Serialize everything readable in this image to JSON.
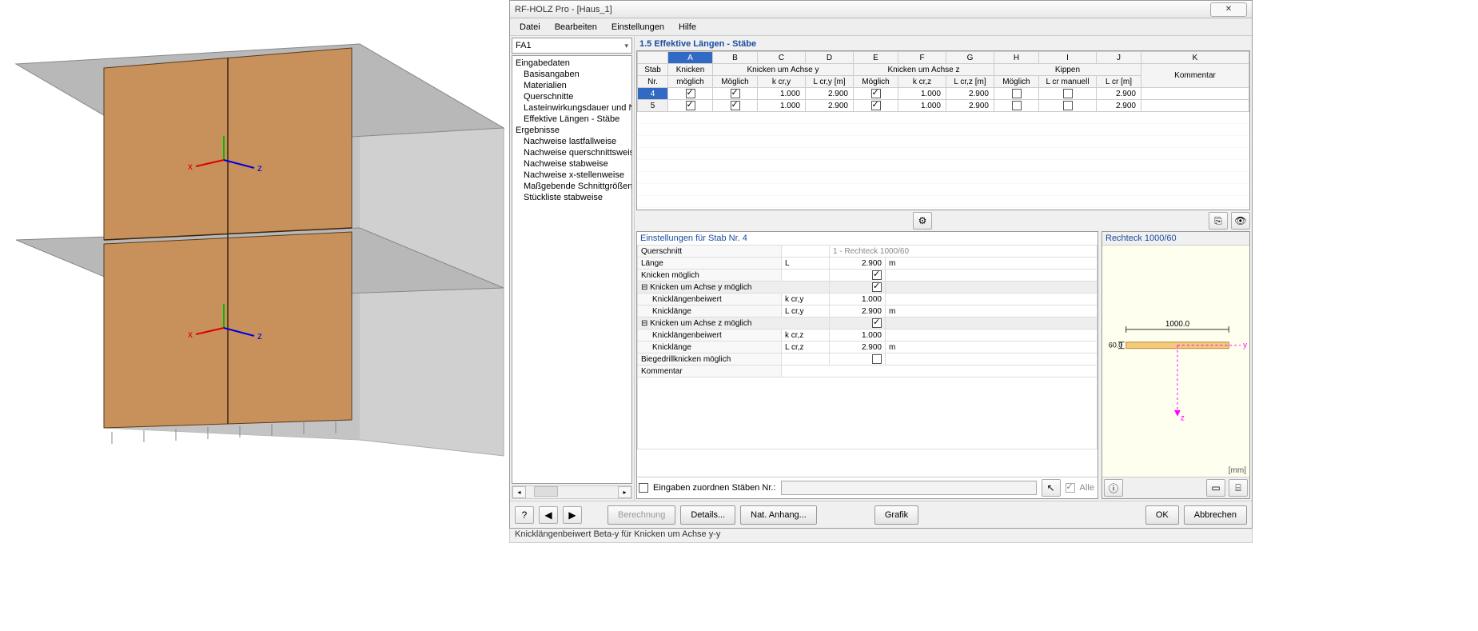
{
  "dialog": {
    "title": "RF-HOLZ Pro - [Haus_1]",
    "close_glyph": "✕"
  },
  "menu": {
    "items": [
      "Datei",
      "Bearbeiten",
      "Einstellungen",
      "Hilfe"
    ]
  },
  "combo": {
    "value": "FA1"
  },
  "tree": {
    "groups": [
      {
        "label": "Eingabedaten",
        "items": [
          "Basisangaben",
          "Materialien",
          "Querschnitte",
          "Lasteinwirkungsdauer und Nutz",
          "Effektive Längen - Stäbe"
        ]
      },
      {
        "label": "Ergebnisse",
        "items": [
          "Nachweise lastfallweise",
          "Nachweise querschnittsweise",
          "Nachweise stabweise",
          "Nachweise x-stellenweise",
          "Maßgebende Schnittgrößen sta",
          "Stückliste stabweise"
        ]
      }
    ]
  },
  "section_title": "1.5 Effektive Längen - Stäbe",
  "table": {
    "cols": [
      "A",
      "B",
      "C",
      "D",
      "E",
      "F",
      "G",
      "H",
      "I",
      "J",
      "K"
    ],
    "row_header_top": "Stab",
    "row_header_bot": "Nr.",
    "group_headers": {
      "knicken": "Knicken",
      "achse_y": "Knicken um Achse y",
      "achse_z": "Knicken um Achse z",
      "kippen": "Kippen"
    },
    "sub_headers": {
      "moeglich": "möglich",
      "Moeglich": "Möglich",
      "kcry": "k cr,y",
      "lcry": "L cr,y [m]",
      "kcrz": "k cr,z",
      "lcrz": "L cr,z [m]",
      "lcr_man": "L cr manuell",
      "lcr": "L cr [m]",
      "kommentar": "Kommentar"
    },
    "rows": [
      {
        "nr": "4",
        "km": true,
        "my": true,
        "kcry": "1.000",
        "lcry": "2.900",
        "mz": true,
        "kcrz": "1.000",
        "lcrz": "2.900",
        "kip_m": false,
        "lcr_man": false,
        "lcr": "2.900",
        "kom": ""
      },
      {
        "nr": "5",
        "km": true,
        "my": true,
        "kcry": "1.000",
        "lcry": "2.900",
        "mz": true,
        "kcrz": "1.000",
        "lcrz": "2.900",
        "kip_m": false,
        "lcr_man": false,
        "lcr": "2.900",
        "kom": ""
      }
    ]
  },
  "settings": {
    "title": "Einstellungen für Stab Nr. 4",
    "rows": {
      "querschnitt_lbl": "Querschnitt",
      "querschnitt_val": "1 - Rechteck 1000/60",
      "laenge_lbl": "Länge",
      "laenge_sym": "L",
      "laenge_val": "2.900",
      "laenge_unit": "m",
      "km_lbl": "Knicken möglich",
      "grp_y": "Knicken um Achse y möglich",
      "kby_lbl": "Knicklängenbeiwert",
      "kby_sym": "k cr,y",
      "kby_val": "1.000",
      "kly_lbl": "Knicklänge",
      "kly_sym": "L cr,y",
      "kly_val": "2.900",
      "kly_unit": "m",
      "grp_z": "Knicken um Achse z möglich",
      "kbz_lbl": "Knicklängenbeiwert",
      "kbz_sym": "k cr,z",
      "kbz_val": "1.000",
      "klz_lbl": "Knicklänge",
      "klz_sym": "L cr,z",
      "klz_val": "2.900",
      "klz_unit": "m",
      "bdk_lbl": "Biegedrillknicken möglich",
      "kom_lbl": "Kommentar"
    }
  },
  "assign": {
    "checkbox_label": "Eingaben zuordnen Stäben Nr.:",
    "alle_label": "Alle"
  },
  "preview": {
    "title": "Rechteck 1000/60",
    "dim_w": "1000.0",
    "dim_h": "60.0",
    "unit": "[mm]",
    "y": "y",
    "z": "z"
  },
  "footer": {
    "berechnung": "Berechnung",
    "details": "Details...",
    "nat_anhang": "Nat. Anhang...",
    "grafik": "Grafik",
    "ok": "OK",
    "abbrechen": "Abbrechen"
  },
  "status": "Knicklängenbeiwert Beta-y für Knicken um Achse y-y",
  "axis": {
    "x": "x",
    "z": "z"
  }
}
